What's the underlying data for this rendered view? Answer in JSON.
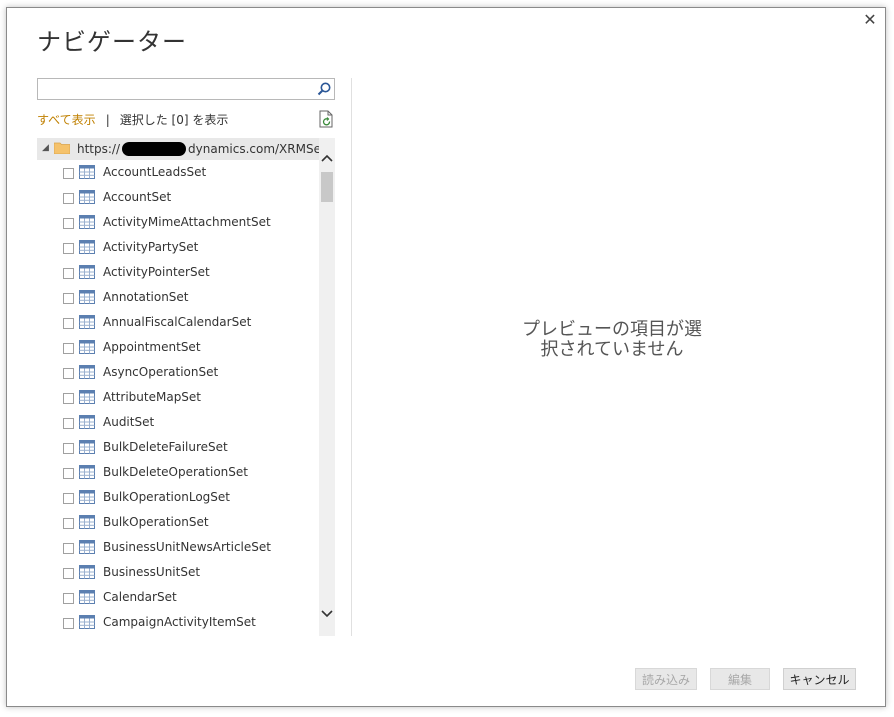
{
  "dialog": {
    "title": "ナビゲーター",
    "close_glyph": "✕"
  },
  "search": {
    "value": "",
    "placeholder": ""
  },
  "filter": {
    "show_all": "すべて表示",
    "separator": "|",
    "show_selected": "選択した [0] を表示"
  },
  "tree": {
    "root": {
      "url_prefix": "https://",
      "url_suffix": "dynamics.com/XRMServi..."
    },
    "items": [
      {
        "label": "AccountLeadsSet"
      },
      {
        "label": "AccountSet"
      },
      {
        "label": "ActivityMimeAttachmentSet"
      },
      {
        "label": "ActivityPartySet"
      },
      {
        "label": "ActivityPointerSet"
      },
      {
        "label": "AnnotationSet"
      },
      {
        "label": "AnnualFiscalCalendarSet"
      },
      {
        "label": "AppointmentSet"
      },
      {
        "label": "AsyncOperationSet"
      },
      {
        "label": "AttributeMapSet"
      },
      {
        "label": "AuditSet"
      },
      {
        "label": "BulkDeleteFailureSet"
      },
      {
        "label": "BulkDeleteOperationSet"
      },
      {
        "label": "BulkOperationLogSet"
      },
      {
        "label": "BulkOperationSet"
      },
      {
        "label": "BusinessUnitNewsArticleSet"
      },
      {
        "label": "BusinessUnitSet"
      },
      {
        "label": "CalendarSet"
      },
      {
        "label": "CampaignActivityItemSet"
      }
    ]
  },
  "preview": {
    "line1": "プレビューの項目が選",
    "line2": "択されていません"
  },
  "buttons": {
    "load": "読み込み",
    "edit": "編集",
    "cancel": "キャンセル"
  },
  "colors": {
    "accent_link": "#c08000",
    "table_icon_header": "#4a6fa5"
  }
}
